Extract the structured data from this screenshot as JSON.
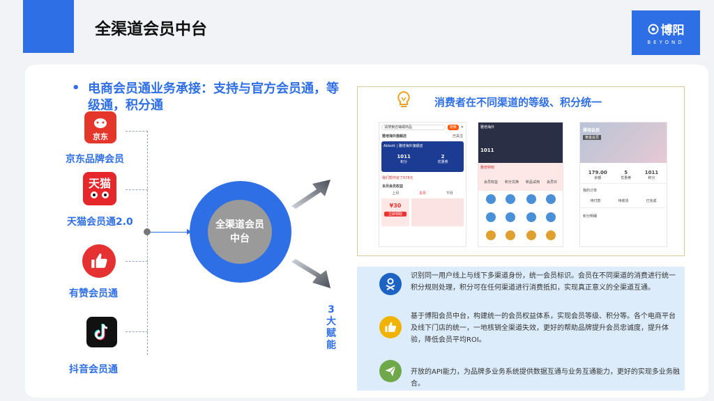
{
  "page": {
    "title": "全渠道会员中台"
  },
  "logo": {
    "name": "博阳",
    "sub": "BEYOND"
  },
  "headline": {
    "bullet": "•",
    "text": "电商会员通业务承接：支持与官方会员通，等级通，积分通"
  },
  "channels": [
    {
      "label": "京东品牌会员",
      "icon_text": "京东",
      "icon": "jd-icon",
      "color": "#e5362c"
    },
    {
      "label": "天猫会员通2.0",
      "icon_text": "天猫",
      "icon": "tmall-icon",
      "color": "#e5262b"
    },
    {
      "label": "有赞会员通",
      "icon_text": "",
      "icon": "youzan-thumb-icon",
      "color": "#e53131"
    },
    {
      "label": "抖音会员通",
      "icon_text": "",
      "icon": "douyin-icon",
      "color": "#111111"
    }
  ],
  "hub": {
    "line1": "全渠道会员",
    "line2": "中台"
  },
  "empower": {
    "text": "3大赋能"
  },
  "consumer_panel": {
    "title": "消费者在不同渠道的等级、积分统一",
    "phone1": {
      "search": "请搜索店铺或商品",
      "search_btn": "搜索",
      "store": "雅培海外旗舰店",
      "follow": "已关注",
      "banner": "Abbott | 雅培海外旗舰店",
      "points": "1011",
      "points_label": "积分",
      "coupons": "2",
      "coupons_label": "优惠券",
      "saved": "我们帮你省了678元",
      "coupon_title": "本月会员权益",
      "months": [
        "上月",
        "本月",
        "下月"
      ],
      "coupon_value": "¥30",
      "coupon_btn": "立即领取"
    },
    "phone2": {
      "store": "雅培海外",
      "points": "1011",
      "member": "雅培特权",
      "menu": [
        "会员权益",
        "积分兑换",
        "新品试用",
        "会员日"
      ]
    },
    "phone3": {
      "name": "雅培会员",
      "level": "黄金会员",
      "stats": [
        {
          "value": "179.00",
          "label": "余额"
        },
        {
          "value": "5",
          "label": "优惠券"
        },
        {
          "value": "1011",
          "label": "积分"
        }
      ],
      "orders": "我的订单",
      "order_items": [
        "待付款",
        "待收货",
        "已完成"
      ],
      "points_detail": "积分明细"
    }
  },
  "features": [
    {
      "icon": "identity-icon",
      "color": "#1d63c4",
      "text": "识别同一用户线上与线下多渠道身份，统一会员标识。会员在不同渠道的消费进行统一积分规则处理，积分可在任何渠道进行消费抵扣，实现真正意义的全渠道互通。"
    },
    {
      "icon": "thumbs-up-icon",
      "color": "#f0b400",
      "text": "基于博阳会员中台，构建统一的会员权益体系，实现会员等级、积分等。各个电商平台及线下门店的统一，一地核销全渠道失效，更好的帮助品牌提升会员忠诚度，提升体验，降低会员平均ROI。"
    },
    {
      "icon": "paper-plane-icon",
      "color": "#6fa84b",
      "text": "开放的API能力，为品牌多业务系统提供数据互通与业务互通能力，更好的实现多业务融合。"
    }
  ]
}
